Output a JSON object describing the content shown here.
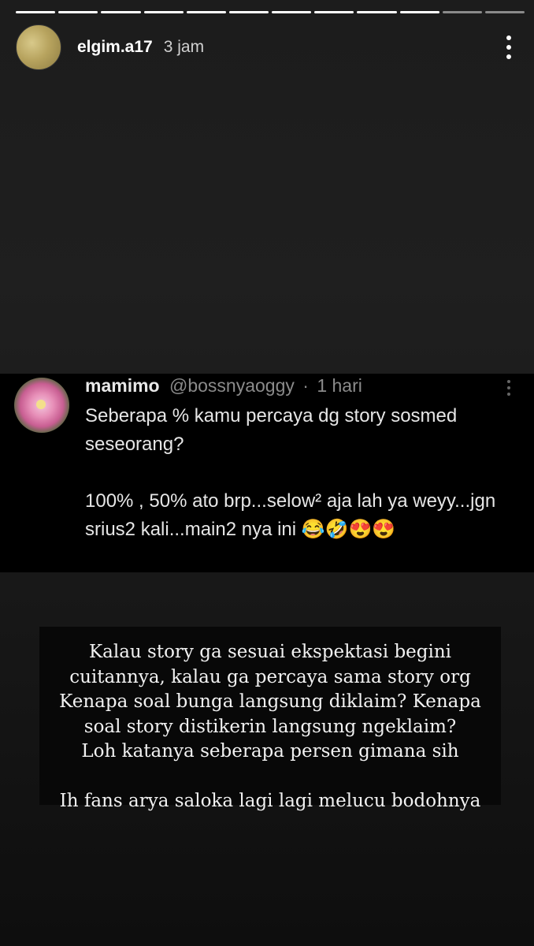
{
  "story": {
    "progress": {
      "total_segments": 12,
      "current_segment": 10
    },
    "username": "elgim.a17",
    "time": "3 jam",
    "more_icon": "vertical-ellipsis-icon"
  },
  "tweet": {
    "name": "mamimo",
    "handle": "@bossnyaoggy",
    "separator": "·",
    "time": "1 hari",
    "body_line1": "Seberapa % kamu percaya dg story sosmed seseorang?",
    "body_line2": "100% , 50% ato brp...selow² aja lah ya weyy...jgn srius2 kali...main2 nya ini 😂🤣😍😍"
  },
  "caption": {
    "lines": [
      "Kalau story ga sesuai ekspektasi begini",
      "cuitannya, kalau ga percaya sama story org",
      "Kenapa soal bunga langsung diklaim? Kenapa",
      "soal story distikerin langsung ngeklaim?",
      "Loh katanya seberapa persen gimana sih"
    ],
    "last_line": "Ih fans arya saloka lagi lagi melucu bodohnya"
  }
}
